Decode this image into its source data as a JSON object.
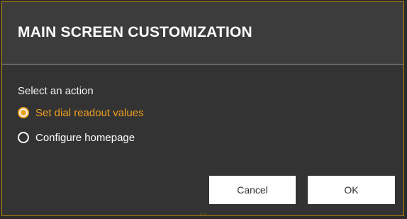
{
  "dialog": {
    "title": "MAIN SCREEN CUSTOMIZATION",
    "prompt": "Select an action",
    "options": [
      {
        "label": "Set dial readout values",
        "selected": true
      },
      {
        "label": "Configure homepage",
        "selected": false
      }
    ],
    "buttons": {
      "cancel_label": "Cancel",
      "ok_label": "OK"
    }
  },
  "colors": {
    "accent": "#f0a020",
    "border": "#b8860b",
    "header_bg": "#3c3c3c",
    "body_bg": "#333333",
    "text": "#ffffff"
  }
}
